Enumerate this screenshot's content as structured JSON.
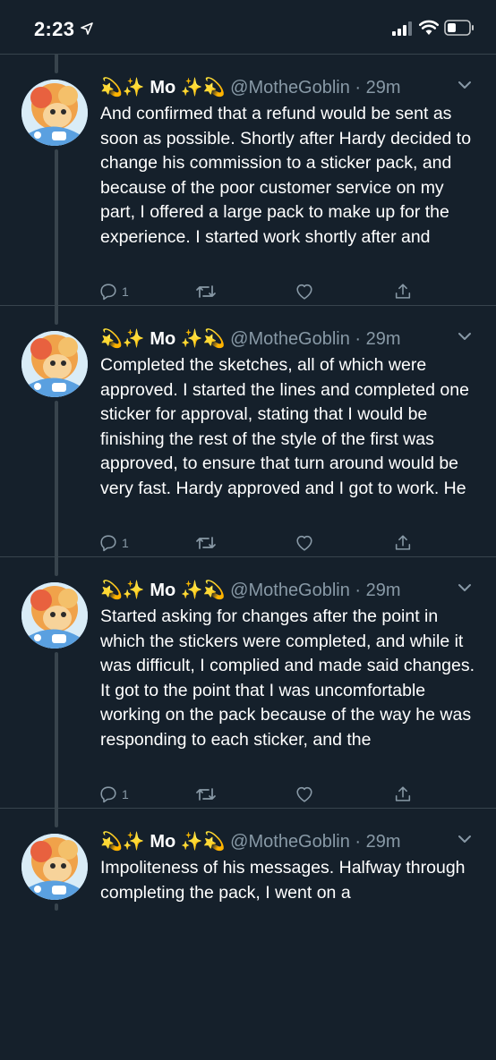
{
  "status": {
    "time": "2:23"
  },
  "tweets": [
    {
      "display_name": "💫✨ Mo ✨💫",
      "handle": "@MotheGoblin",
      "time": "29m",
      "text": "And confirmed that a refund would be sent as soon as possible. Shortly after Hardy decided to change his commission to a sticker pack, and because of the poor customer service on my part, I offered a large pack to make up for the experience. I started work shortly after and",
      "reply_count": "1"
    },
    {
      "display_name": "💫✨ Mo ✨💫",
      "handle": "@MotheGoblin",
      "time": "29m",
      "text": "Completed the sketches, all of which were approved. I started the lines and completed one sticker for approval, stating that I would be finishing the rest of the style of the first was approved, to ensure that turn around would be very fast. Hardy approved and I got to work. He",
      "reply_count": "1"
    },
    {
      "display_name": "💫✨ Mo ✨💫",
      "handle": "@MotheGoblin",
      "time": "29m",
      "text": "Started asking for changes after the point in which the stickers were completed, and while it was difficult, I complied and made said changes. It got to the point that I was uncomfortable working on the pack because of the way he was responding to each sticker, and the",
      "reply_count": "1"
    },
    {
      "display_name": "💫✨ Mo ✨💫",
      "handle": "@MotheGoblin",
      "time": "29m",
      "text": "Impoliteness of his messages. Halfway through completing the pack, I went on a",
      "reply_count": ""
    }
  ],
  "separator": " · ",
  "icons": {
    "reply": "reply-icon",
    "retweet": "retweet-icon",
    "like": "heart-icon",
    "share": "share-icon",
    "more": "chevron-down-icon"
  },
  "colors": {
    "background": "#15202b",
    "secondary_text": "#8899a6",
    "divider": "#38444d"
  }
}
